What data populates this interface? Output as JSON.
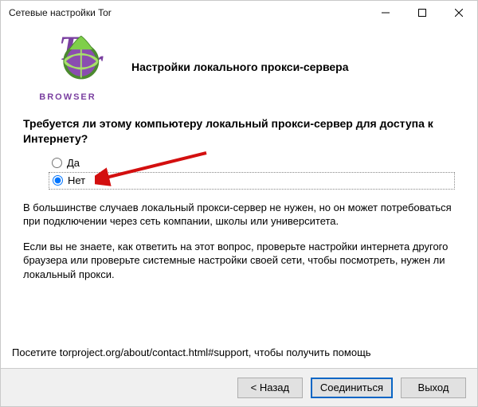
{
  "window": {
    "title": "Сетевые настройки Tor"
  },
  "logo": {
    "browser_label": "BROWSER"
  },
  "header": {
    "heading": "Настройки локального прокси-сервера"
  },
  "main": {
    "question": "Требуется ли этому компьютеру локальный прокси-сервер для доступа к Интернету?",
    "options": {
      "yes": "Да",
      "no": "Нет",
      "selected": "no"
    },
    "paragraph1": "В большинстве случаев локальный прокси-сервер не нужен, но он может потребоваться при подключении через сеть компании, школы или университета.",
    "paragraph2": "Если вы не знаете, как ответить на этот вопрос, проверьте настройки интернета другого браузера или проверьте системные настройки своей сети, чтобы посмотреть, нужен ли локальный прокси."
  },
  "annotation": {
    "arrow_color": "#d30f0f",
    "target": "no"
  },
  "footer": {
    "help_text": "Посетите torproject.org/about/contact.html#support, чтобы получить помощь",
    "buttons": {
      "back": "< Назад",
      "connect": "Соединиться",
      "exit": "Выход"
    }
  }
}
